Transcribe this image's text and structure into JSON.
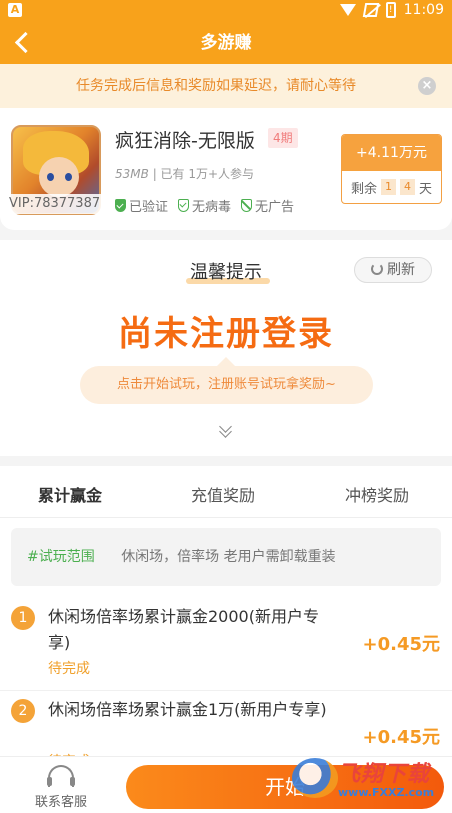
{
  "status_bar": {
    "time": "11:09",
    "left_icon": "A",
    "battery": "!"
  },
  "app_bar": {
    "title": "多游赚"
  },
  "notice": {
    "text": "任务完成后信息和奖励如果延迟，请耐心等待",
    "close": "×"
  },
  "game": {
    "name": "疯狂消除-无限版",
    "period": "4期",
    "vip_id": "VIP:78377387",
    "size": "53MB",
    "participants": "| 已有 1万+人参与",
    "badges": [
      "已验证",
      "无病毒",
      "无广告"
    ],
    "reward": "+4.11万元",
    "remain_label": "剩余",
    "remain_a": "1",
    "remain_b": "4",
    "remain_unit": "天"
  },
  "tip": {
    "title": "温馨提示",
    "refresh": "刷新",
    "status": "尚未注册登录",
    "hint": "点击开始试玩，注册账号试玩拿奖励~"
  },
  "tabs": [
    {
      "label": "累计赢金",
      "active": true
    },
    {
      "label": "充值奖励",
      "active": false
    },
    {
      "label": "冲榜奖励",
      "active": false
    }
  ],
  "scope": {
    "label": "#试玩范围",
    "text": "休闲场，倍率场 老用户需卸载重装"
  },
  "tasks": [
    {
      "index": "1",
      "title": "休闲场倍率场累计赢金2000(新用户专享)",
      "state": "待完成",
      "reward": "+0.45元"
    },
    {
      "index": "2",
      "title": "休闲场倍率场累计赢金1万(新用户专享)",
      "state": "待完成",
      "reward": "+0.45元"
    }
  ],
  "bottom": {
    "service": "联系客服",
    "start": "开始"
  },
  "watermark": {
    "text": "飞翔下载",
    "url": "www.FXXZ.com"
  },
  "colors": {
    "brand": "#f8a21b",
    "accent": "#f56b12",
    "success": "#4caf50"
  },
  "icons": [
    "back-arrow-icon",
    "close-icon",
    "shield-check-icon",
    "refresh-icon",
    "chevron-double-down-icon",
    "headset-icon"
  ]
}
